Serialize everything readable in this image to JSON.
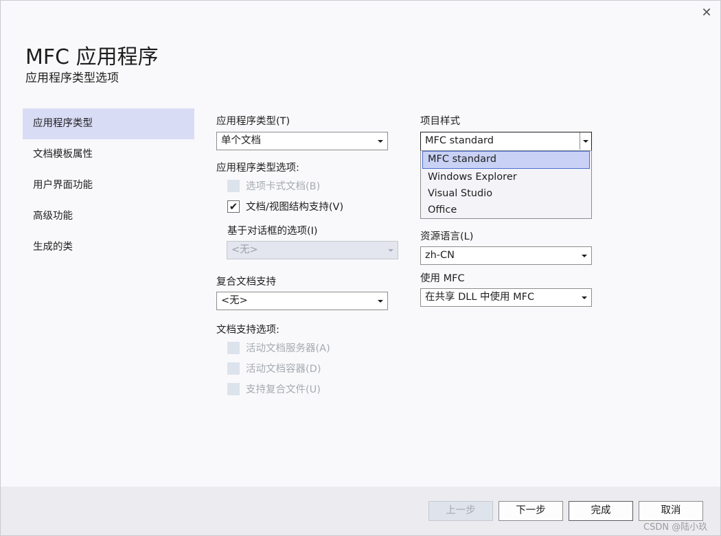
{
  "window": {
    "title": "MFC 应用程序",
    "subtitle": "应用程序类型选项",
    "close_glyph": "✕"
  },
  "sidebar": {
    "items": [
      {
        "label": "应用程序类型",
        "active": true
      },
      {
        "label": "文档模板属性"
      },
      {
        "label": "用户界面功能"
      },
      {
        "label": "高级功能"
      },
      {
        "label": "生成的类"
      }
    ]
  },
  "app_type": {
    "label": "应用程序类型(T)",
    "value": "单个文档"
  },
  "app_type_options": {
    "label": "应用程序类型选项:",
    "tabbed_docs": {
      "label": "选项卡式文档(B)",
      "checked": false,
      "enabled": false
    },
    "doc_view": {
      "label": "文档/视图结构支持(V)",
      "checked": true,
      "enabled": true,
      "check_glyph": "✔"
    }
  },
  "dialog_options": {
    "label": "基于对话框的选项(I)",
    "value": "<无>"
  },
  "compound_doc": {
    "label": "复合文档支持",
    "value": "<无>"
  },
  "doc_support": {
    "label": "文档支持选项:",
    "active_server": "活动文档服务器(A)",
    "active_container": "活动文档容器(D)",
    "compound_files": "支持复合文件(U)"
  },
  "project_style": {
    "label": "项目样式",
    "value": "MFC standard",
    "options": [
      "MFC standard",
      "Windows Explorer",
      "Visual Studio",
      "Office"
    ]
  },
  "resource_lang": {
    "label": "资源语言(L)",
    "value": "zh-CN"
  },
  "use_mfc": {
    "label": "使用 MFC",
    "value": "在共享 DLL 中使用 MFC"
  },
  "buttons": {
    "prev": "上一步",
    "next": "下一步",
    "finish": "完成",
    "cancel": "取消"
  },
  "watermark": "CSDN @陆小玖",
  "colors": {
    "active_nav": "#d9dcf5",
    "selected_option": "#c9d2f5",
    "accent_border": "#4a6fd0"
  }
}
